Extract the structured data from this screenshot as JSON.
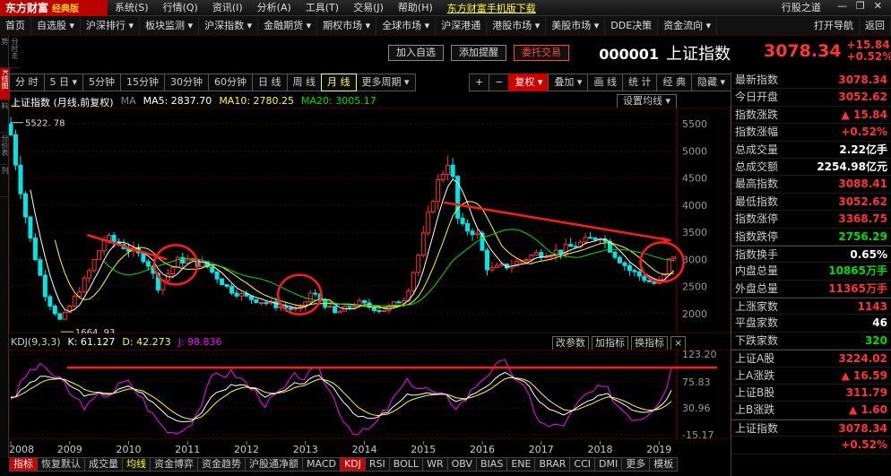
{
  "menubar": {
    "logo": "东方财富",
    "logo_sub": "经典版",
    "items": [
      "系统(S)",
      "行情(Q)",
      "资讯(I)",
      "分析(A)",
      "工具(T)",
      "交易(J)",
      "帮助(H)"
    ],
    "promo": "东方财富手机版下载",
    "right_item": "行股之道"
  },
  "navbar": {
    "items": [
      "首页",
      "自选股 ▾",
      "沪深排行 ▾",
      "板块监测 ▾",
      "沪深指数 ▾",
      "金融期货 ▾",
      "期权市场 ▾",
      "全球市场 ▾",
      "沪深港通",
      "港股市场 ▾",
      "美股市场 ▾",
      "DDE决策",
      "资金流向 ▾"
    ],
    "right": [
      "打开导航",
      "返回"
    ]
  },
  "lefttabs": [
    "分时走势",
    "K线图",
    "个股资料",
    "分价表",
    "多股同列"
  ],
  "actions": {
    "add_watch": "加入自选",
    "add_alert": "添加提醒",
    "trade": "委托交易"
  },
  "stock": {
    "code": "000001",
    "name": "上证指数",
    "price": "3078.34",
    "change": "+15.84",
    "pct": "+0.52%"
  },
  "periods": [
    "分 时",
    "5 日 ▾",
    "5分钟",
    "15分钟",
    "30分钟",
    "60分钟",
    "日 线",
    "周 线",
    "月 线",
    "更多周期 ▾"
  ],
  "tools": [
    "+",
    "−",
    "复权 ▾",
    "叠加 ▾",
    "画 线",
    "统 计",
    "经 典",
    "隐藏 ▾"
  ],
  "ma": {
    "title": "上证指数 (月线,前复权)",
    "icon": "MA",
    "ma5": "MA5: 2837.70",
    "ma10": "MA10: 2780.25",
    "ma20": "MA20: 3005.17",
    "settings": "设置均线 ▾"
  },
  "kdj": {
    "label": "KDJ(9,3,3)",
    "k": "K: 61.127",
    "d": "D: 42.273",
    "j": "J: 98.836",
    "buttons": [
      "改参数",
      "加指标",
      "换指标",
      "×"
    ]
  },
  "chart_data": [
    {
      "type": "candlestick",
      "title": "上证指数 (月线,前复权)",
      "y_ticks": [
        2000,
        2500,
        3000,
        3500,
        4000,
        4500,
        5000,
        5500
      ],
      "ylim": [
        1700,
        5700
      ],
      "annotations": [
        {
          "text": "5522. 78",
          "value": 5522.78,
          "year": 2008.0
        },
        {
          "text": "1664. 93",
          "value": 1664.93,
          "year": 2008.85
        }
      ],
      "x_years": [
        "2008",
        "2009",
        "2010",
        "2011",
        "2012",
        "2013",
        "2014",
        "2015",
        "2016",
        "2017",
        "2018",
        "2019"
      ],
      "series": [
        {
          "name": "MA5",
          "color": "#ffffff"
        },
        {
          "name": "MA10",
          "color": "#ffff00"
        },
        {
          "name": "MA20",
          "color": "#00dd00"
        }
      ],
      "approx_monthly_close": [
        {
          "year": 2008.0,
          "value": 5300
        },
        {
          "year": 2008.3,
          "value": 3500
        },
        {
          "year": 2008.6,
          "value": 2300
        },
        {
          "year": 2008.85,
          "value": 1850
        },
        {
          "year": 2009.3,
          "value": 2700
        },
        {
          "year": 2009.6,
          "value": 3400
        },
        {
          "year": 2009.9,
          "value": 3250
        },
        {
          "year": 2010.3,
          "value": 3000
        },
        {
          "year": 2010.5,
          "value": 2500
        },
        {
          "year": 2010.85,
          "value": 3000
        },
        {
          "year": 2011.3,
          "value": 2900
        },
        {
          "year": 2011.7,
          "value": 2450
        },
        {
          "year": 2012.0,
          "value": 2300
        },
        {
          "year": 2012.5,
          "value": 2150
        },
        {
          "year": 2012.9,
          "value": 2050
        },
        {
          "year": 2013.1,
          "value": 2400
        },
        {
          "year": 2013.5,
          "value": 2000
        },
        {
          "year": 2013.9,
          "value": 2200
        },
        {
          "year": 2014.3,
          "value": 2050
        },
        {
          "year": 2014.7,
          "value": 2300
        },
        {
          "year": 2014.95,
          "value": 3200
        },
        {
          "year": 2015.2,
          "value": 4300
        },
        {
          "year": 2015.45,
          "value": 4900
        },
        {
          "year": 2015.6,
          "value": 3600
        },
        {
          "year": 2015.9,
          "value": 3500
        },
        {
          "year": 2016.1,
          "value": 2800
        },
        {
          "year": 2016.5,
          "value": 2900
        },
        {
          "year": 2016.9,
          "value": 3100
        },
        {
          "year": 2017.3,
          "value": 3150
        },
        {
          "year": 2017.8,
          "value": 3350
        },
        {
          "year": 2018.0,
          "value": 3450
        },
        {
          "year": 2018.2,
          "value": 3150
        },
        {
          "year": 2018.5,
          "value": 2800
        },
        {
          "year": 2018.9,
          "value": 2550
        },
        {
          "year": 2019.05,
          "value": 2600
        },
        {
          "year": 2019.2,
          "value": 3078
        }
      ],
      "trendlines": [
        {
          "from": {
            "year": 2009.3,
            "value": 3450
          },
          "to": {
            "year": 2010.65,
            "value": 3000
          }
        },
        {
          "from": {
            "year": 2015.35,
            "value": 4050
          },
          "to": {
            "year": 2019.2,
            "value": 3350
          }
        }
      ],
      "circles": [
        {
          "year": 2010.8,
          "value": 2900
        },
        {
          "year": 2012.9,
          "value": 2350
        },
        {
          "year": 2019.05,
          "value": 2950
        }
      ]
    },
    {
      "type": "line",
      "title": "KDJ(9,3,3)",
      "y_ticks": [
        -15.17,
        30.96,
        75.83,
        123.2
      ],
      "y_tick_labels": [
        "-15.17",
        "30.96",
        "75.83",
        "123.20"
      ],
      "ylim": [
        -20,
        128
      ],
      "series": [
        {
          "name": "K",
          "color": "#ffffff",
          "last": 61.127
        },
        {
          "name": "D",
          "color": "#ffff00",
          "last": 42.273
        },
        {
          "name": "J",
          "color": "#ff00ff",
          "last": 98.836
        }
      ],
      "trendline_value": 100
    }
  ],
  "bottom_tabs": [
    "指标",
    "恢复默认",
    "成交量",
    "均线",
    "资金博弈",
    "资金趋势",
    "沪股通净额",
    "MACD",
    "KDJ",
    "RSI",
    "BOLL",
    "WR",
    "OBV",
    "BIAS",
    "ENE",
    "BRAR",
    "CCI",
    "DMI",
    "更多",
    "模板"
  ],
  "quote_panel": [
    {
      "label": "最新指数",
      "value": "3078.34",
      "color": "#ff3333"
    },
    {
      "label": "今日开盘",
      "value": "3052.62",
      "color": "#ff3333"
    },
    {
      "label": "指数涨跌",
      "value": "▲ 15.84",
      "color": "#ff3333"
    },
    {
      "label": "指数涨幅",
      "value": "+0.52%",
      "color": "#ff3333"
    },
    {
      "label": "总成交量",
      "value": "2.22亿手",
      "color": "#ffffff"
    },
    {
      "label": "总成交额",
      "value": "2254.98亿元",
      "color": "#ffffff"
    },
    {
      "label": "最高指数",
      "value": "3088.41",
      "color": "#ff3333"
    },
    {
      "label": "最低指数",
      "value": "3052.62",
      "color": "#ff3333"
    },
    {
      "label": "指数涨停",
      "value": "3368.75",
      "color": "#ff3333"
    },
    {
      "label": "指数跌停",
      "value": "2756.29",
      "color": "#00dd00"
    },
    {
      "label": "指数换手",
      "value": "0.65%",
      "color": "#ffffff"
    },
    {
      "label": "内盘总量",
      "value": "10865万手",
      "color": "#00dd00"
    },
    {
      "label": "外盘总量",
      "value": "11365万手",
      "color": "#ff3333"
    },
    {
      "label": "上涨家数",
      "value": "1143",
      "color": "#ff3333"
    },
    {
      "label": "平盘家数",
      "value": "46",
      "color": "#ffffff"
    },
    {
      "label": "下跌家数",
      "value": "320",
      "color": "#00dd00"
    },
    {
      "label": "上证A股",
      "value": "3224.02",
      "color": "#ff3333"
    },
    {
      "label": "上A涨跌",
      "value": "▲ 16.59",
      "color": "#ff3333"
    },
    {
      "label": "上证B股",
      "value": "311.79",
      "color": "#ff3333"
    },
    {
      "label": "上B涨跌",
      "value": "▲ 1.60",
      "color": "#ff3333"
    },
    {
      "label": "上证指数",
      "value": "3078.34",
      "color": "#ff3333"
    },
    {
      "label": "",
      "value": "+0.52%",
      "color": "#ff3333"
    }
  ]
}
